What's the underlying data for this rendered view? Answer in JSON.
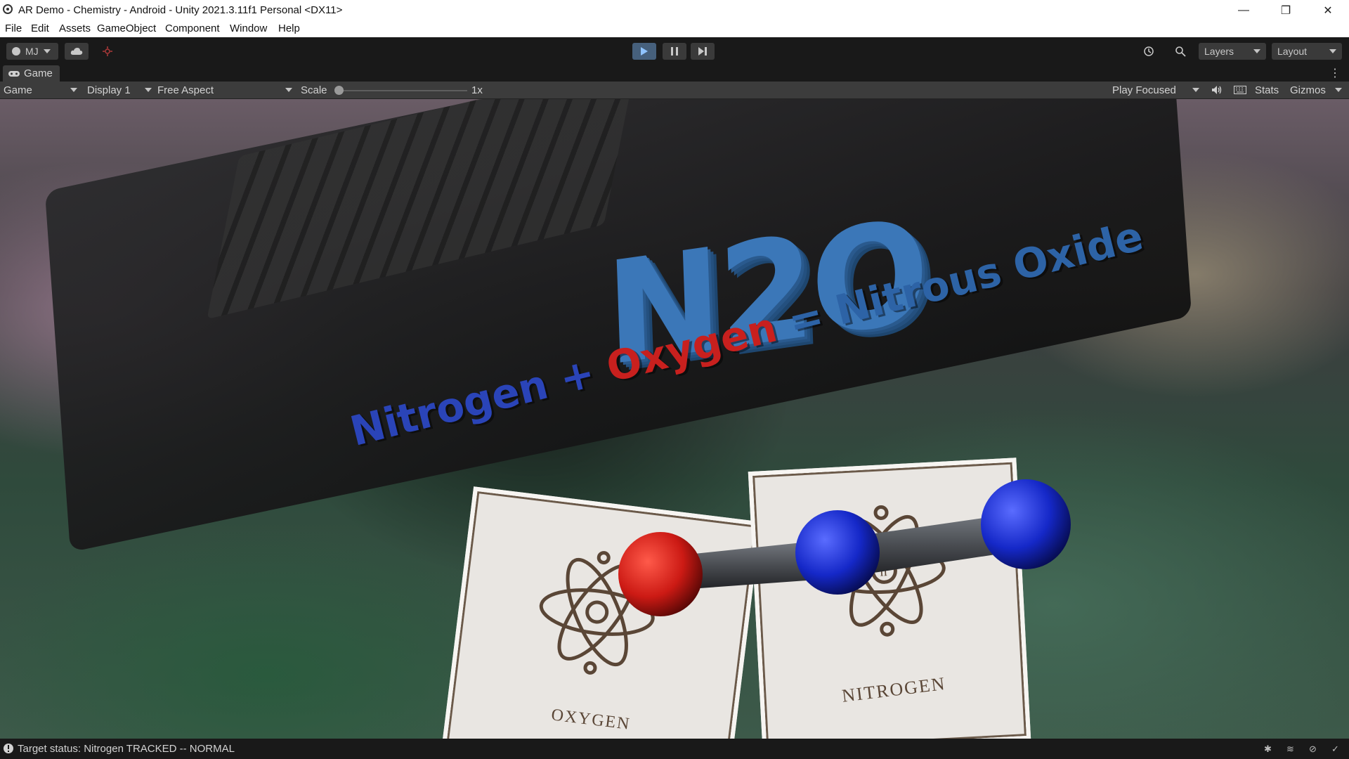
{
  "window": {
    "title": "AR Demo - Chemistry - Android - Unity 2021.3.11f1 Personal <DX11>",
    "minimize": "—",
    "restore": "❐",
    "close": "✕"
  },
  "menu": {
    "items": [
      "File",
      "Edit",
      "Assets",
      "GameObject",
      "Component",
      "Window",
      "Help"
    ]
  },
  "toolbar": {
    "account_label": "MJ",
    "layers_label": "Layers",
    "layout_label": "Layout"
  },
  "game_tab": {
    "label": "Game"
  },
  "game_toolbar": {
    "view_select": "Game",
    "display_select": "Display 1",
    "aspect_select": "Free Aspect",
    "scale_label": "Scale",
    "scale_value": "1x",
    "play_mode_select": "Play Focused",
    "stats_label": "Stats",
    "gizmos_label": "Gizmos"
  },
  "scene": {
    "formula": "N2O",
    "equation_part1": "Nitrogen",
    "equation_plus": "+",
    "equation_part2": "Oxygen",
    "equation_equals": "=",
    "equation_result": "Nitrous Oxide",
    "card_oxygen": "OXYGEN",
    "card_nitrogen": "NITROGEN",
    "atom_colors": {
      "oxygen": "#cc1a14",
      "nitrogen": "#1528c8",
      "bond": "#4a4d52"
    }
  },
  "status": {
    "text": "Target status: Nitrogen TRACKED -- NORMAL"
  },
  "colors": {
    "editor_bg": "#191919",
    "toolbar_bg": "#3c3c3c",
    "play_active": "#46607c"
  }
}
